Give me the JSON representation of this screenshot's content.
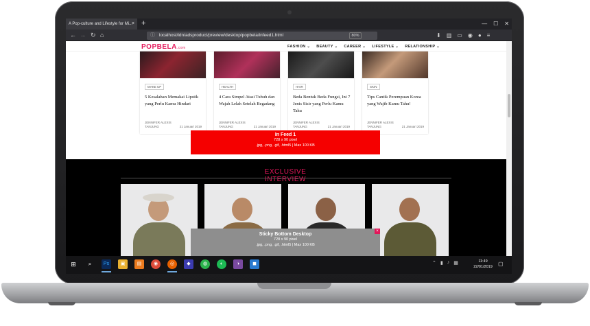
{
  "browser": {
    "tab_title": "A Pop-culture and Lifestyle for Mi...",
    "tab_close": "×",
    "new_tab": "+",
    "url": "localhost/idn/adsproduct/preview/desktop/popbela/infeed1.html",
    "zoom": "80%",
    "back": "←",
    "forward": "→",
    "reload": "↻",
    "home": "⌂"
  },
  "site": {
    "logo": "POPBELA",
    "logo_suffix": ".com",
    "menu": [
      "FASHION ⌄",
      "BEAUTY ⌄",
      "CAREER ⌄",
      "LIFESTYLE ⌄",
      "RELATIONSHIP ⌄"
    ]
  },
  "cards": [
    {
      "category": "MAKE UP",
      "title": "5 Kesalahan Memakai Lipstik yang Perlu Kamu Hindari",
      "author": "JENNIFER ALEXIS TANJUNG",
      "date": "21 Januari 2019"
    },
    {
      "category": "HEALTH",
      "title": "4 Cara Simpel Atasi Tubuh dan Wajah Lelah Setelah Begadang",
      "author": "JENNIFER ALEXIS TANJUNG",
      "date": "21 Januari 2019"
    },
    {
      "category": "HAIR",
      "title": "Beda Bentuk Beda Fungsi, Ini 7 Jenis Sisir yang Perlu Kamu Tahu",
      "author": "JENNIFER ALEXIS TANJUNG",
      "date": "21 Januari 2019"
    },
    {
      "category": "SKIN",
      "title": "Tips Cantik Perempuan Korea yang Wajib Kamu Tahu!",
      "author": "JENNIFER ALEXIS TANJUNG",
      "date": "21 Januari 2019"
    }
  ],
  "ad_infeed": {
    "title": "In Feed 1",
    "size": "728 x 90 pixel",
    "format": ".jpg, .png, .gif, .html5 | Max 100 KB"
  },
  "exclusive": {
    "heading": "EXCLUSIVE INTERVIEW"
  },
  "ad_sticky": {
    "title": "Sticky Bottom Desktop",
    "size": "728 x 90 pixel",
    "format": ".jpg, .png, .gif, .html5 | Max 100 KB",
    "close": "×"
  },
  "taskbar": {
    "time": "11:49",
    "date": "22/01/2019",
    "apps": [
      "Ps",
      "▣",
      "▤",
      "◉",
      "◎",
      "◆",
      "◍",
      "◐",
      "◑",
      "◼"
    ]
  },
  "colors": {
    "brand": "#e3175a",
    "ad_red": "#f50000"
  }
}
